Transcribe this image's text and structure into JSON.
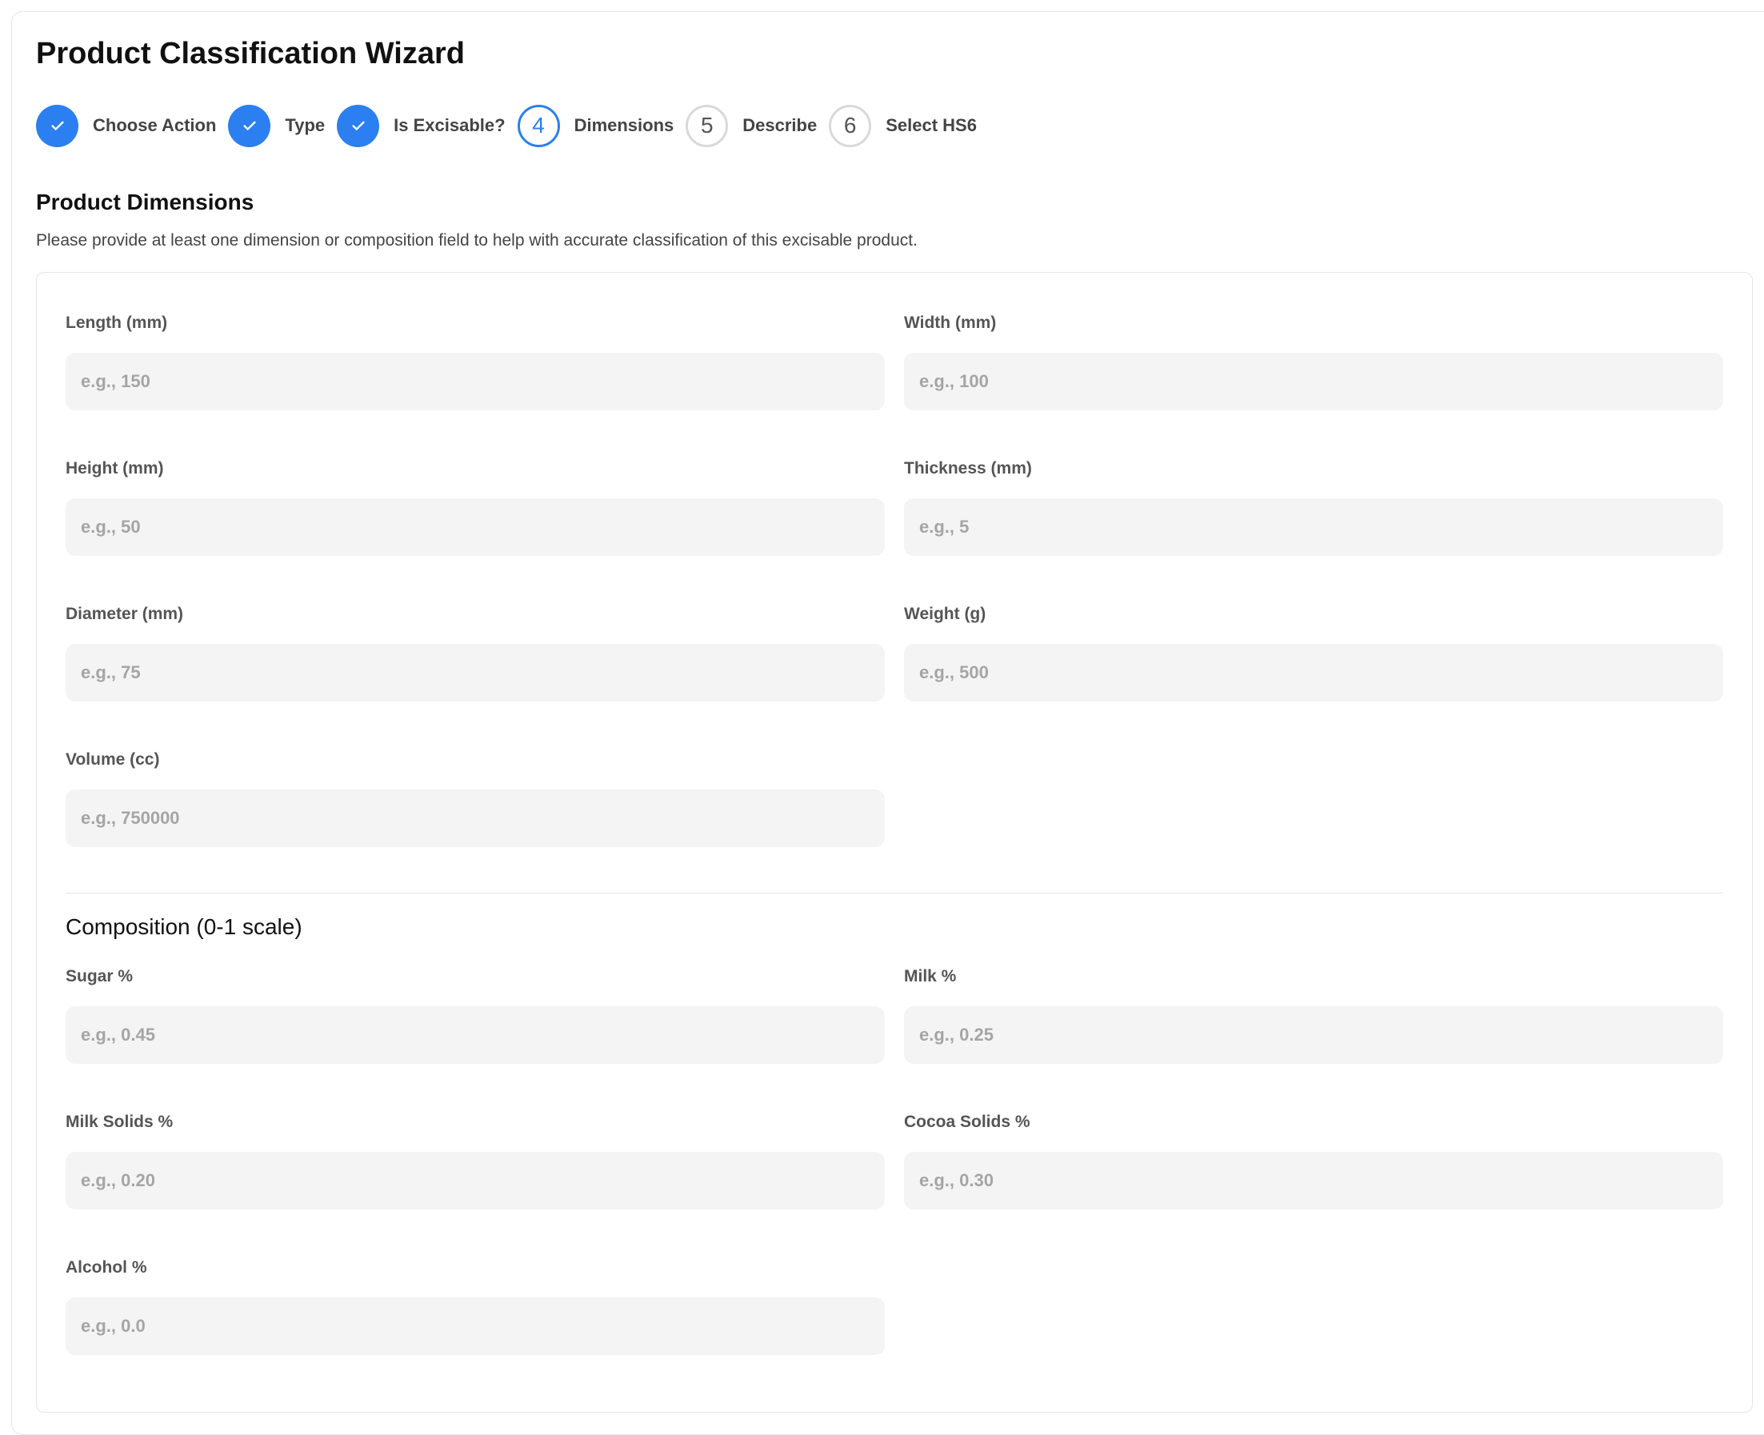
{
  "wizard": {
    "title": "Product Classification Wizard",
    "accent_color": "#2b7ff0",
    "steps": [
      {
        "label": "Choose Action",
        "state": "done",
        "icon": "check-icon"
      },
      {
        "label": "Type",
        "state": "done",
        "icon": "check-icon"
      },
      {
        "label": "Is Excisable?",
        "state": "done",
        "icon": "check-icon"
      },
      {
        "number": "4",
        "label": "Dimensions",
        "state": "current"
      },
      {
        "number": "5",
        "label": "Describe",
        "state": "todo"
      },
      {
        "number": "6",
        "label": "Select HS6",
        "state": "todo"
      }
    ]
  },
  "section": {
    "title": "Product Dimensions",
    "description": "Please provide at least one dimension or composition field to help with accurate classification of this excisable product."
  },
  "dimensions": {
    "length": {
      "label": "Length (mm)",
      "placeholder": "e.g., 150"
    },
    "width": {
      "label": "Width (mm)",
      "placeholder": "e.g., 100"
    },
    "height": {
      "label": "Height (mm)",
      "placeholder": "e.g., 50"
    },
    "thickness": {
      "label": "Thickness (mm)",
      "placeholder": "e.g., 5"
    },
    "diameter": {
      "label": "Diameter (mm)",
      "placeholder": "e.g., 75"
    },
    "weight": {
      "label": "Weight (g)",
      "placeholder": "e.g., 500"
    },
    "volume": {
      "label": "Volume (cc)",
      "placeholder": "e.g., 750000"
    }
  },
  "composition": {
    "title": "Composition (0-1 scale)",
    "sugar": {
      "label": "Sugar %",
      "placeholder": "e.g., 0.45"
    },
    "milk": {
      "label": "Milk %",
      "placeholder": "e.g., 0.25"
    },
    "milk_solids": {
      "label": "Milk Solids %",
      "placeholder": "e.g., 0.20"
    },
    "cocoa_solids": {
      "label": "Cocoa Solids %",
      "placeholder": "e.g., 0.30"
    },
    "alcohol": {
      "label": "Alcohol %",
      "placeholder": "e.g., 0.0"
    }
  }
}
